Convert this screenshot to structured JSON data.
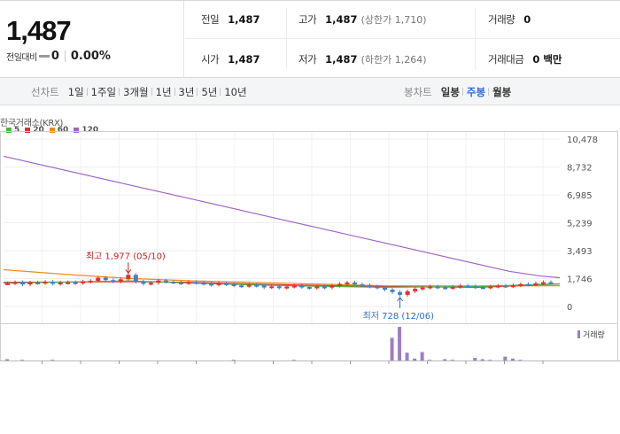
{
  "quote": {
    "price": "1,487",
    "change_label": "전일대비",
    "change_value": "0",
    "change_pct": "0.00%",
    "prev_close_label": "전일",
    "prev_close": "1,487",
    "open_label": "시가",
    "open": "1,487",
    "high_label": "고가",
    "high": "1,487",
    "upper_limit": "(상한가 1,710)",
    "low_label": "저가",
    "low": "1,487",
    "lower_limit": "(하한가 1,264)",
    "volume_label": "거래량",
    "volume": "0",
    "amount_label": "거래대금",
    "amount": "0 백만"
  },
  "toolbar": {
    "line_chart_label": "선차트",
    "periods": [
      "1일",
      "1주일",
      "3개월",
      "1년",
      "3년",
      "5년",
      "10년"
    ],
    "candle_chart_label": "봉차트",
    "candle_periods": [
      "일봉",
      "주봉",
      "월봉"
    ],
    "active_candle": "주봉"
  },
  "chart": {
    "market": "한국거래소(KRX)",
    "volume_legend": "거래량",
    "high_annotation": "최고 1,977 (05/10)",
    "low_annotation": "최저 728 (12/06)",
    "colors": {
      "up": "#e0302f",
      "down": "#3c7fd6",
      "ma5": "#4db34d",
      "ma20": "#e0302f",
      "ma60": "#f08a1c",
      "ma120": "#a064c8",
      "volume": "#9a7fc7"
    }
  },
  "chart_data": {
    "type": "candlestick",
    "title": "",
    "y_ticks": [
      "10,478",
      "8,732",
      "6,985",
      "5,239",
      "3,493",
      "1,746",
      "0"
    ],
    "ylim": [
      0,
      10478
    ],
    "moving_averages": [
      {
        "name": "5",
        "color": "#4db34d"
      },
      {
        "name": "20",
        "color": "#e0302f"
      },
      {
        "name": "60",
        "color": "#f08a1c"
      },
      {
        "name": "120",
        "color": "#a064c8"
      }
    ],
    "ma120": [
      [
        0,
        9400
      ],
      [
        10,
        8500
      ],
      [
        20,
        7600
      ],
      [
        30,
        6700
      ],
      [
        40,
        5800
      ],
      [
        50,
        4900
      ],
      [
        60,
        4000
      ],
      [
        70,
        3100
      ],
      [
        80,
        2200
      ],
      [
        85,
        1900
      ],
      [
        88,
        1800
      ]
    ],
    "ma60": [
      [
        0,
        2300
      ],
      [
        10,
        2000
      ],
      [
        20,
        1750
      ],
      [
        30,
        1600
      ],
      [
        45,
        1450
      ],
      [
        60,
        1300
      ],
      [
        75,
        1280
      ],
      [
        88,
        1300
      ]
    ],
    "ma20": [
      [
        0,
        1500
      ],
      [
        20,
        1550
      ],
      [
        30,
        1500
      ],
      [
        45,
        1350
      ],
      [
        60,
        1250
      ],
      [
        75,
        1200
      ],
      [
        88,
        1400
      ]
    ],
    "ma5": [
      [
        0,
        1450
      ],
      [
        20,
        1600
      ],
      [
        30,
        1450
      ],
      [
        45,
        1300
      ],
      [
        60,
        1200
      ],
      [
        75,
        1250
      ],
      [
        88,
        1420
      ]
    ],
    "candles": [
      1450,
      1520,
      1380,
      1500,
      1470,
      1540,
      1420,
      1490,
      1510,
      1470,
      1560,
      1600,
      1800,
      1650,
      1560,
      1700,
      1977,
      1550,
      1420,
      1480,
      1620,
      1550,
      1500,
      1460,
      1530,
      1480,
      1420,
      1360,
      1450,
      1390,
      1320,
      1280,
      1350,
      1300,
      1200,
      1260,
      1180,
      1240,
      1300,
      1220,
      1160,
      1250,
      1180,
      1300,
      1420,
      1500,
      1380,
      1320,
      1250,
      1180,
      1050,
      900,
      728,
      950,
      1100,
      1180,
      1250,
      1200,
      1150,
      1220,
      1300,
      1260,
      1200,
      1180,
      1250,
      1300,
      1270,
      1320,
      1400,
      1380,
      1450,
      1520,
      1480
    ],
    "volume": [
      2,
      0,
      1,
      0,
      0,
      0,
      1,
      0,
      0,
      0,
      0,
      0,
      0,
      0,
      0,
      0,
      0,
      0,
      0,
      0,
      0,
      0,
      0,
      0,
      0,
      0,
      0,
      0,
      0,
      0,
      1,
      0,
      0,
      0,
      0,
      0,
      0,
      0,
      1,
      0,
      0,
      0,
      0,
      0,
      0,
      0,
      0,
      0,
      0,
      0,
      0,
      35,
      52,
      12,
      3,
      13,
      1,
      0,
      2,
      1,
      0,
      0,
      4,
      2,
      1,
      0,
      6,
      3,
      1,
      0,
      0,
      0,
      0
    ]
  }
}
